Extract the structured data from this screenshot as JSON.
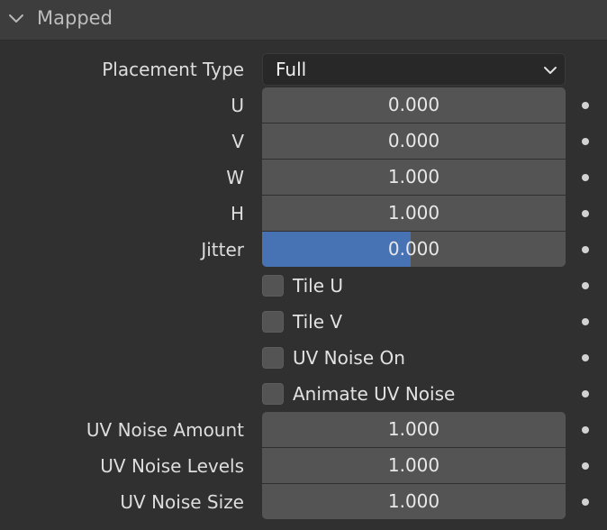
{
  "panel": {
    "title": "Mapped",
    "chevron_icon": "chevron-down-icon"
  },
  "placement": {
    "label": "Placement Type",
    "value": "Full",
    "arrow_icon": "chevron-down-icon"
  },
  "fields": {
    "u": {
      "label": "U",
      "value": "0.000"
    },
    "v": {
      "label": "V",
      "value": "0.000"
    },
    "w": {
      "label": "W",
      "value": "1.000"
    },
    "h": {
      "label": "H",
      "value": "1.000"
    },
    "jitter": {
      "label": "Jitter",
      "value": "0.000",
      "fill_fraction": 0.49
    },
    "uv_noise_amount": {
      "label": "UV Noise Amount",
      "value": "1.000"
    },
    "uv_noise_levels": {
      "label": "UV Noise Levels",
      "value": "1.000"
    },
    "uv_noise_size": {
      "label": "UV Noise Size",
      "value": "1.000"
    }
  },
  "checkboxes": {
    "tile_u": {
      "label": "Tile U",
      "checked": false
    },
    "tile_v": {
      "label": "Tile V",
      "checked": false
    },
    "uv_noise_on": {
      "label": "UV Noise On",
      "checked": false
    },
    "animate_uv_noise": {
      "label": "Animate UV Noise",
      "checked": false
    }
  },
  "icons": {
    "keyframe": "keyframe-dot-icon"
  },
  "colors": {
    "background": "#303030",
    "header": "#3d3d3d",
    "field": "#545454",
    "dropdown": "#282828",
    "accent": "#4772b3",
    "text": "#dddddd"
  }
}
